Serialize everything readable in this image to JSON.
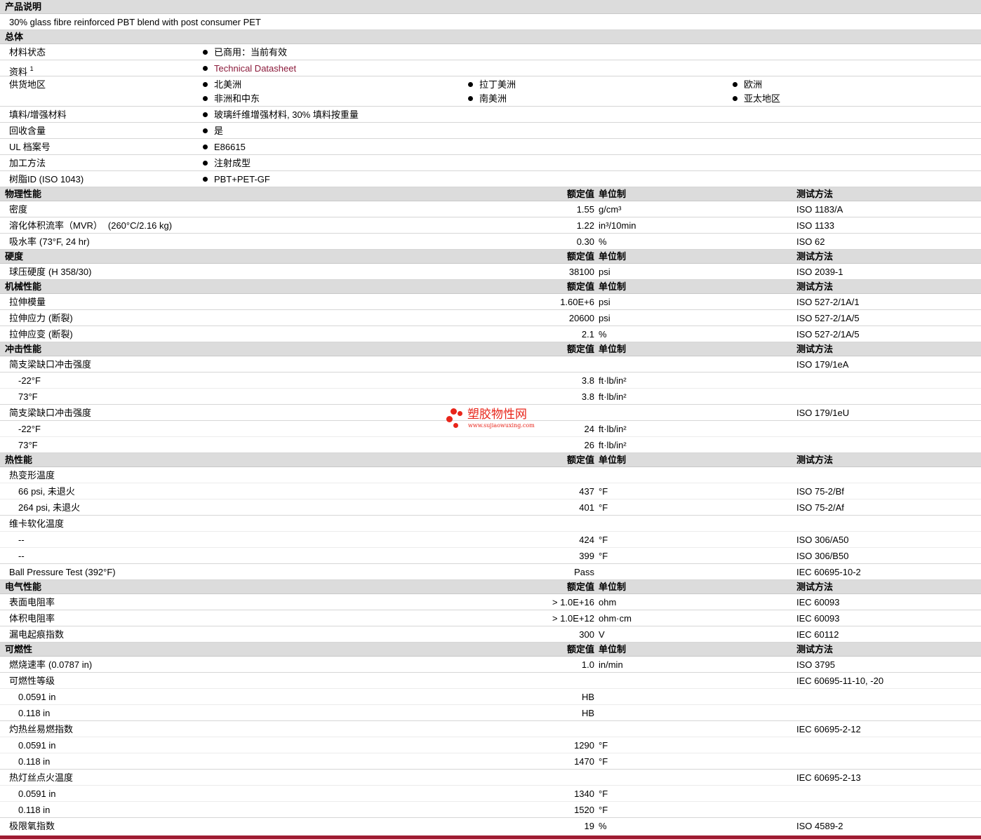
{
  "product": {
    "section": "产品说明",
    "description": "30% glass fibre reinforced PBT blend with post consumer PET"
  },
  "general": {
    "section": "总体",
    "status": {
      "label": "材料状态",
      "value": "已商用：当前有效"
    },
    "docs": {
      "label": "资料",
      "sup": "1",
      "value": "Technical Datasheet"
    },
    "regions": {
      "label": "供货地区",
      "items": [
        "北美洲",
        "拉丁美洲",
        "欧洲",
        "非洲和中东",
        "南美洲",
        "亚太地区"
      ]
    },
    "filler": {
      "label": "填料/增强材料",
      "value": "玻璃纤维增强材料, 30% 填料按重量"
    },
    "recycled": {
      "label": "回收含量",
      "value": "是"
    },
    "ul": {
      "label": "UL 档案号",
      "value": "E86615"
    },
    "process": {
      "label": "加工方法",
      "value": "注射成型"
    },
    "resin": {
      "label": "树脂ID (ISO 1043)",
      "value": "PBT+PET-GF"
    }
  },
  "headers": {
    "nominal": "额定值",
    "unit": "单位制",
    "test": "测试方法"
  },
  "physical": {
    "section": "物理性能",
    "rows": [
      {
        "name": "密度",
        "cond": "",
        "value": "1.55",
        "unit": "g/cm³",
        "test": "ISO 1183/A"
      },
      {
        "name": "溶化体积流率（MVR）",
        "cond": "(260°C/2.16 kg)",
        "value": "1.22",
        "unit": "in³/10min",
        "test": "ISO 1133"
      },
      {
        "name": "吸水率",
        "cond": "(73°F, 24 hr)",
        "value": "0.30",
        "unit": "%",
        "test": "ISO 62"
      }
    ]
  },
  "hardness": {
    "section": "硬度",
    "rows": [
      {
        "name": "球压硬度",
        "cond": "(H 358/30)",
        "value": "38100",
        "unit": "psi",
        "test": "ISO 2039-1"
      }
    ]
  },
  "mechanical": {
    "section": "机械性能",
    "rows": [
      {
        "name": "拉伸模量",
        "cond": "",
        "value": "1.60E+6",
        "unit": "psi",
        "test": "ISO 527-2/1A/1"
      },
      {
        "name": "拉伸应力",
        "cond": "(断裂)",
        "value": "20600",
        "unit": "psi",
        "test": "ISO 527-2/1A/5"
      },
      {
        "name": "拉伸应变",
        "cond": "(断裂)",
        "value": "2.1",
        "unit": "%",
        "test": "ISO 527-2/1A/5"
      }
    ]
  },
  "impact": {
    "section": "冲击性能",
    "g1": {
      "name": "简支梁缺口冲击强度",
      "test": "ISO 179/1eA",
      "r1": {
        "name": "-22°F",
        "value": "3.8",
        "unit": "ft·lb/in²"
      },
      "r2": {
        "name": "73°F",
        "value": "3.8",
        "unit": "ft·lb/in²"
      }
    },
    "g2": {
      "name": "简支梁缺口冲击强度",
      "test": "ISO 179/1eU",
      "r1": {
        "name": "-22°F",
        "value": "24",
        "unit": "ft·lb/in²"
      },
      "r2": {
        "name": "73°F",
        "value": "26",
        "unit": "ft·lb/in²"
      }
    }
  },
  "thermal": {
    "section": "热性能",
    "hdt": {
      "name": "热变形温度",
      "r1": {
        "name": "66 psi, 未退火",
        "value": "437",
        "unit": "°F",
        "test": "ISO 75-2/Bf"
      },
      "r2": {
        "name": "264 psi, 未退火",
        "value": "401",
        "unit": "°F",
        "test": "ISO 75-2/Af"
      }
    },
    "vicat": {
      "name": "维卡软化温度",
      "r1": {
        "name": "--",
        "value": "424",
        "unit": "°F",
        "test": "ISO 306/A50"
      },
      "r2": {
        "name": "--",
        "value": "399",
        "unit": "°F",
        "test": "ISO 306/B50"
      }
    },
    "ball": {
      "name": "Ball Pressure Test (392°F)",
      "value": "Pass",
      "test": "IEC 60695-10-2"
    }
  },
  "electrical": {
    "section": "电气性能",
    "rows": [
      {
        "name": "表面电阻率",
        "value": "> 1.0E+16",
        "unit": "ohm",
        "test": "IEC 60093"
      },
      {
        "name": "体积电阻率",
        "value": "> 1.0E+12",
        "unit": "ohm·cm",
        "test": "IEC 60093"
      },
      {
        "name": "漏电起痕指数",
        "value": "300",
        "unit": "V",
        "test": "IEC 60112"
      }
    ]
  },
  "flammability": {
    "section": "可燃性",
    "burn": {
      "name": "燃烧速率",
      "cond": "(0.0787 in)",
      "value": "1.0",
      "unit": "in/min",
      "test": "ISO 3795"
    },
    "rating": {
      "name": "可燃性等级",
      "test": "IEC 60695-11-10, -20",
      "r1": {
        "name": "0.0591 in",
        "value": "HB"
      },
      "r2": {
        "name": "0.118 in",
        "value": "HB"
      }
    },
    "gwfi": {
      "name": "灼热丝易燃指数",
      "test": "IEC 60695-2-12",
      "r1": {
        "name": "0.0591 in",
        "value": "1290",
        "unit": "°F"
      },
      "r2": {
        "name": "0.118 in",
        "value": "1470",
        "unit": "°F"
      }
    },
    "gwit": {
      "name": "热灯丝点火温度",
      "test": "IEC 60695-2-13",
      "r1": {
        "name": "0.0591 in",
        "value": "1340",
        "unit": "°F"
      },
      "r2": {
        "name": "0.118 in",
        "value": "1520",
        "unit": "°F"
      }
    },
    "loi": {
      "name": "极限氧指数",
      "value": "19",
      "unit": "%",
      "test": "ISO 4589-2"
    }
  },
  "watermark": {
    "title": "塑胶物性网",
    "url": "www.sujiaowuxing.com"
  },
  "colors": {
    "header_bg": "#dcdcdc",
    "link": "#8b1a3a",
    "brand_red": "#e8251a",
    "bottom_bar": "#9e1b32"
  }
}
